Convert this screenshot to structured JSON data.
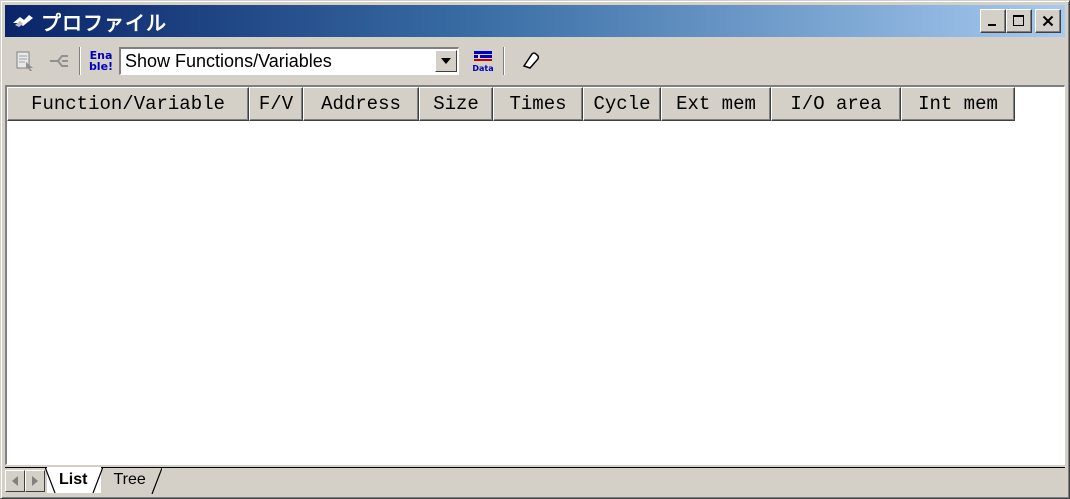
{
  "window": {
    "title": "プロファイル",
    "icon": "profile-app-icon",
    "controls": {
      "minimize": "minimize-icon",
      "maximize": "maximize-icon",
      "close": "close-icon"
    }
  },
  "toolbar": {
    "buttons": [
      "jump-to-source-icon",
      "tree-collapse-icon"
    ],
    "enable_label_top": "Ena",
    "enable_label_bottom": "ble!",
    "filter_select": {
      "value": "Show Functions/Variables"
    },
    "data_icon_label": "Data",
    "clear_icon": "eraser-icon"
  },
  "table": {
    "columns": [
      "Function/Variable",
      "F/V",
      "Address",
      "Size",
      "Times",
      "Cycle",
      "Ext mem",
      "I/O area",
      "Int mem"
    ],
    "rows": []
  },
  "tabs": [
    {
      "label": "List",
      "active": true
    },
    {
      "label": "Tree",
      "active": false
    }
  ],
  "colors": {
    "title_start": "#0a246a",
    "title_end": "#a6caf0",
    "face": "#d4d0c8"
  }
}
